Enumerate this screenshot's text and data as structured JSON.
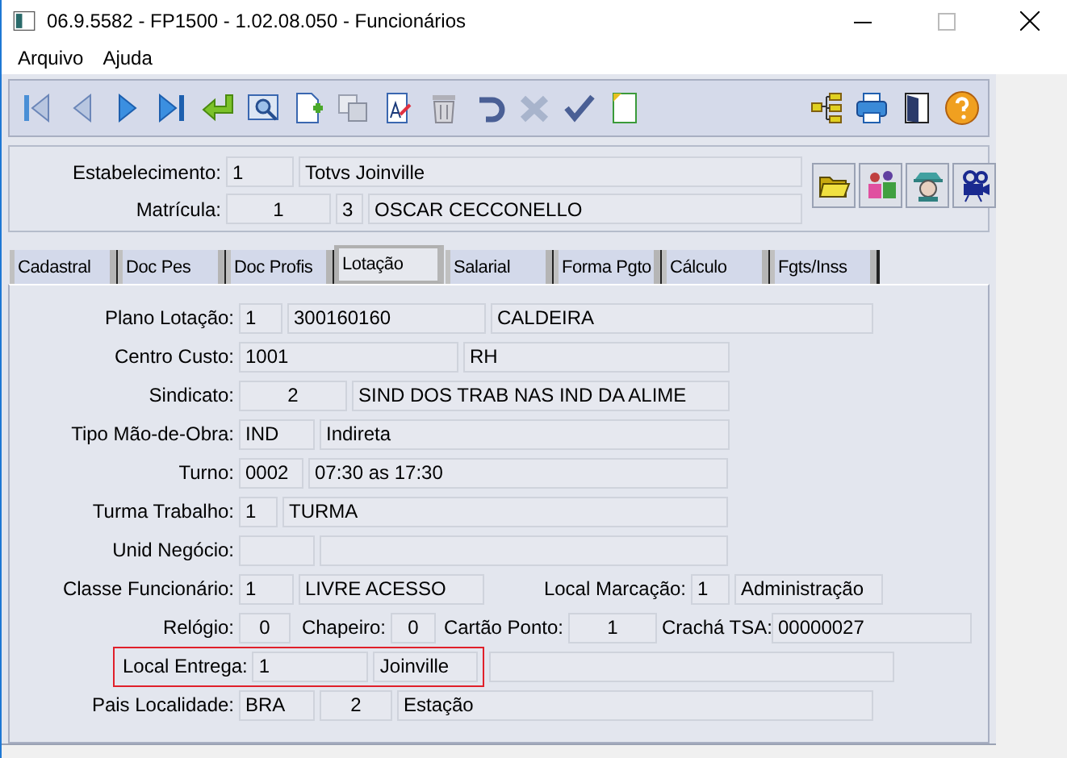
{
  "window": {
    "title": "06.9.5582 - FP1500 - 1.02.08.050 - Funcionários"
  },
  "menu": [
    {
      "label": "Arquivo"
    },
    {
      "label": "Ajuda"
    }
  ],
  "header": {
    "rows": [
      {
        "label": "Estabelecimento:",
        "values": [
          "1",
          "Totvs Joinville"
        ]
      },
      {
        "label": "Matrícula:",
        "values": [
          "1",
          "3",
          "OSCAR CECCONELLO"
        ]
      }
    ]
  },
  "tabs": [
    {
      "label": "Cadastral",
      "selected": false
    },
    {
      "label": "Doc Pes",
      "selected": false
    },
    {
      "label": "Doc Profis",
      "selected": false
    },
    {
      "label": "Lotação",
      "selected": true
    },
    {
      "label": "Salarial",
      "selected": false
    },
    {
      "label": "Forma Pgto",
      "selected": false
    },
    {
      "label": "Cálculo",
      "selected": false
    },
    {
      "label": "Fgts/Inss",
      "selected": false
    }
  ],
  "form": {
    "rows": [
      {
        "highlighted": false,
        "groups": [
          {
            "label": "Plano Lotação:",
            "values": [
              "1",
              "300160160",
              "CALDEIRA"
            ]
          }
        ]
      },
      {
        "highlighted": false,
        "groups": [
          {
            "label": "Centro Custo:",
            "values": [
              "1001",
              "RH"
            ]
          }
        ]
      },
      {
        "highlighted": false,
        "groups": [
          {
            "label": "Sindicato:",
            "values": [
              "2",
              "SIND DOS TRAB NAS IND DA ALIME"
            ]
          }
        ]
      },
      {
        "highlighted": false,
        "groups": [
          {
            "label": "Tipo Mão-de-Obra:",
            "values": [
              "IND",
              "Indireta"
            ]
          }
        ]
      },
      {
        "highlighted": false,
        "groups": [
          {
            "label": "Turno:",
            "values": [
              "0002",
              "07:30 as 17:30"
            ]
          }
        ]
      },
      {
        "highlighted": false,
        "groups": [
          {
            "label": "Turma Trabalho:",
            "values": [
              "1",
              "TURMA"
            ]
          }
        ]
      },
      {
        "highlighted": false,
        "groups": [
          {
            "label": "Unid Negócio:"
          }
        ]
      },
      {
        "highlighted": false,
        "groups": [
          {
            "label": "Classe Funcionário:",
            "values": [
              "1",
              "LIVRE ACESSO"
            ]
          },
          {
            "label": "Local Marcação:",
            "values": [
              "1",
              "Administração"
            ]
          }
        ]
      },
      {
        "highlighted": false,
        "groups": [
          {
            "label": "Relógio:",
            "values": [
              "0"
            ]
          },
          {
            "label": "Chapeiro:",
            "values": [
              "0"
            ]
          },
          {
            "label": "Cartão Ponto:",
            "values": [
              "1"
            ]
          },
          {
            "label": "Crachá TSA:",
            "values": [
              "00000027"
            ]
          }
        ]
      },
      {
        "highlighted": true,
        "groups": [
          {
            "label": "Local Entrega:",
            "values": [
              "1",
              "Joinville"
            ]
          }
        ]
      },
      {
        "highlighted": false,
        "groups": [
          {
            "label": "Pais Localidade:",
            "values": [
              "BRA",
              "2",
              "Estação"
            ]
          }
        ]
      }
    ]
  }
}
